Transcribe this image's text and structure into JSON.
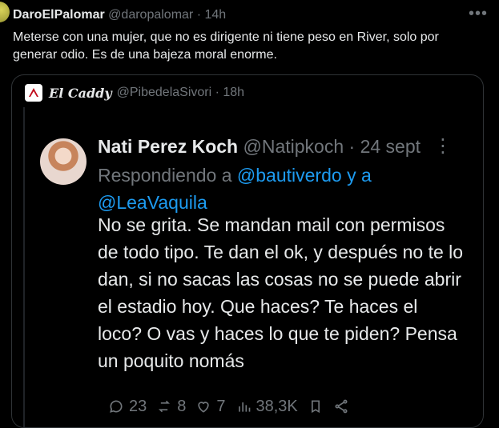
{
  "outer_tweet": {
    "name": "DaroElPalomar",
    "handle": "@daropalomar",
    "time": "14h",
    "text": "Meterse con una mujer, que no es dirigente ni tiene peso en River, solo por generar odio. Es de una bajeza moral enorme."
  },
  "quoted_tweet": {
    "name": "El Caddy",
    "handle": "@PibedelaSivori",
    "time": "18h",
    "inner": {
      "name": "Nati Perez Koch",
      "handle": "@Natipkoch",
      "date": "24 sept",
      "reply_prefix": "Respondiendo a",
      "reply_user_1": "@bautiverdo",
      "reply_joiner": "y a",
      "reply_user_2": "@LeaVaquila",
      "text": "No se grita. Se mandan mail con permisos de todo tipo. Te dan el ok, y después no te lo dan, si no sacas las cosas no se puede abrir el estadio hoy. Que haces? Te haces el loco? O vas y haces lo que te piden? Pensa un poquito nomás",
      "actions": {
        "replies": "23",
        "reposts": "8",
        "likes": "7",
        "views": "38,3K"
      }
    }
  },
  "icons": [
    "avatar",
    "more-icon",
    "logo-icon",
    "reply-icon",
    "repost-icon",
    "like-icon",
    "views-icon",
    "bookmark-icon",
    "share-icon"
  ]
}
